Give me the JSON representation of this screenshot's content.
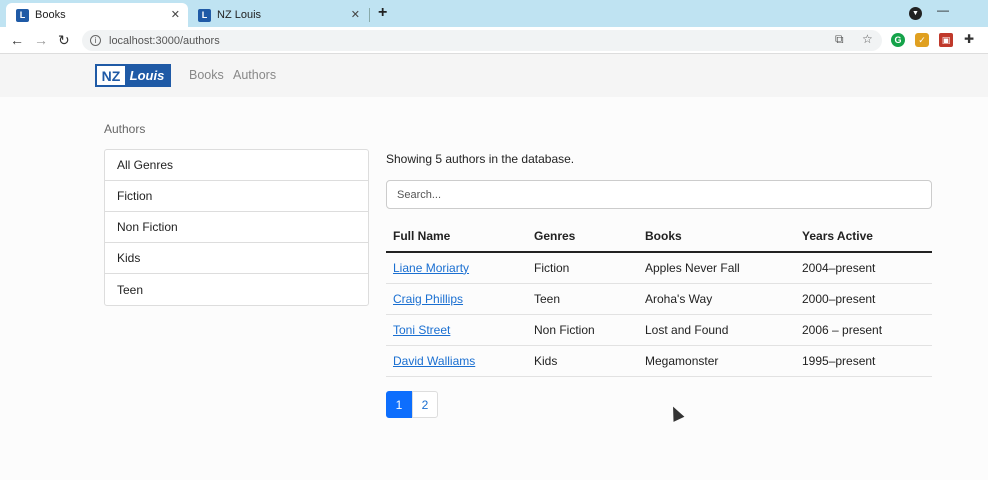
{
  "browser": {
    "tabs": [
      {
        "title": "Books",
        "favicon": "L",
        "active": true
      },
      {
        "title": "NZ Louis",
        "favicon": "L",
        "active": false
      }
    ],
    "new_tab": "+",
    "url": "localhost:3000/authors"
  },
  "navbar": {
    "logo_nz": "NZ",
    "logo_louis": "Louis",
    "links": [
      "Books",
      "Authors"
    ]
  },
  "sidebar": {
    "title": "Authors",
    "genres": [
      "All Genres",
      "Fiction",
      "Non Fiction",
      "Kids",
      "Teen"
    ]
  },
  "main": {
    "showing_text": "Showing 5 authors in the database.",
    "search_placeholder": "Search...",
    "table": {
      "headers": [
        "Full Name",
        "Genres",
        "Books",
        "Years Active"
      ],
      "rows": [
        [
          "Liane Moriarty",
          "Fiction",
          "Apples Never Fall",
          "2004–present"
        ],
        [
          "Craig Phillips",
          "Teen",
          "Aroha's Way",
          "2000–present"
        ],
        [
          "Toni Street",
          "Non Fiction",
          "Lost and Found",
          "2006 – present"
        ],
        [
          "David Walliams",
          "Kids",
          "Megamonster",
          "1995–present"
        ]
      ]
    },
    "pagination": [
      "1",
      "2"
    ]
  },
  "colors": {
    "brand": "#1f5aa6",
    "link": "#1a6fd1",
    "active_page": "#0d6efd"
  }
}
